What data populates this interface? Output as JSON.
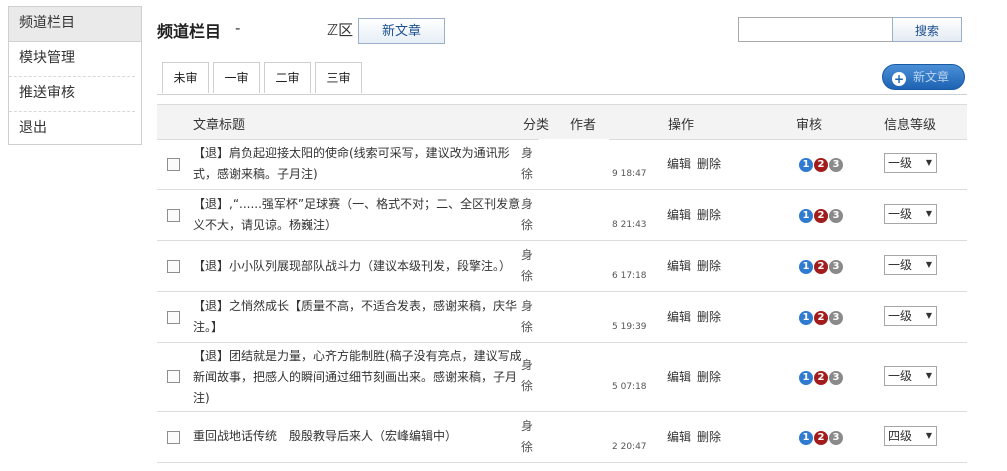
{
  "sidebar": {
    "items": [
      {
        "label": "频道栏目"
      },
      {
        "label": "模块管理"
      },
      {
        "label": "推送审核"
      },
      {
        "label": "退出"
      }
    ]
  },
  "header": {
    "title": "频道栏目",
    "dash": "-",
    "fragment": "ℤ区",
    "new_article": "新文章",
    "search_button": "搜索",
    "search_value": ""
  },
  "tabs": [
    {
      "label": "未审"
    },
    {
      "label": "一审"
    },
    {
      "label": "二审"
    },
    {
      "label": "三审"
    }
  ],
  "new_article_blue": "新文章",
  "table": {
    "headers": {
      "title": "文章标题",
      "category": "分类",
      "author": "作者",
      "ops": "操作",
      "review": "审核",
      "level": "信息等级"
    },
    "edit_label": "编辑",
    "delete_label": "删除",
    "badge_labels": [
      "1",
      "2",
      "3"
    ],
    "rows": [
      {
        "title": "【退】肩负起迎接太阳的使命(线索可采写，建议改为通讯形式，感谢来稿。子月注)",
        "category": "身 徐",
        "time": "9 18:47",
        "level": "一级"
      },
      {
        "title": "【退】,“......强军杯”足球赛（一、格式不对；二、全区刊发意义不大，请见谅。杨巍注）",
        "category": "身 徐",
        "time": "8 21:43",
        "level": "一级"
      },
      {
        "title": "【退】小小队列展现部队战斗力（建议本级刊发，段擎注。）",
        "category": "身 徐",
        "time": "6 17:18",
        "level": "一级"
      },
      {
        "title": "【退】之悄然成长【质量不高，不适合发表，感谢来稿，庆华注。】",
        "category": "身 徐",
        "time": "5 19:39",
        "level": "一级"
      },
      {
        "title": "【退】团结就是力量，心齐方能制胜(稿子没有亮点，建议写成新闻故事，把感人的瞬间通过细节刻画出来。感谢来稿，子月注)",
        "category": "身 徐",
        "time": "5 07:18",
        "level": "一级"
      },
      {
        "title": "重回战地话传统　殷殷教导后来人（宏峰编辑中）",
        "category": "身 徐",
        "time": "2 20:47",
        "level": "四级"
      }
    ]
  }
}
